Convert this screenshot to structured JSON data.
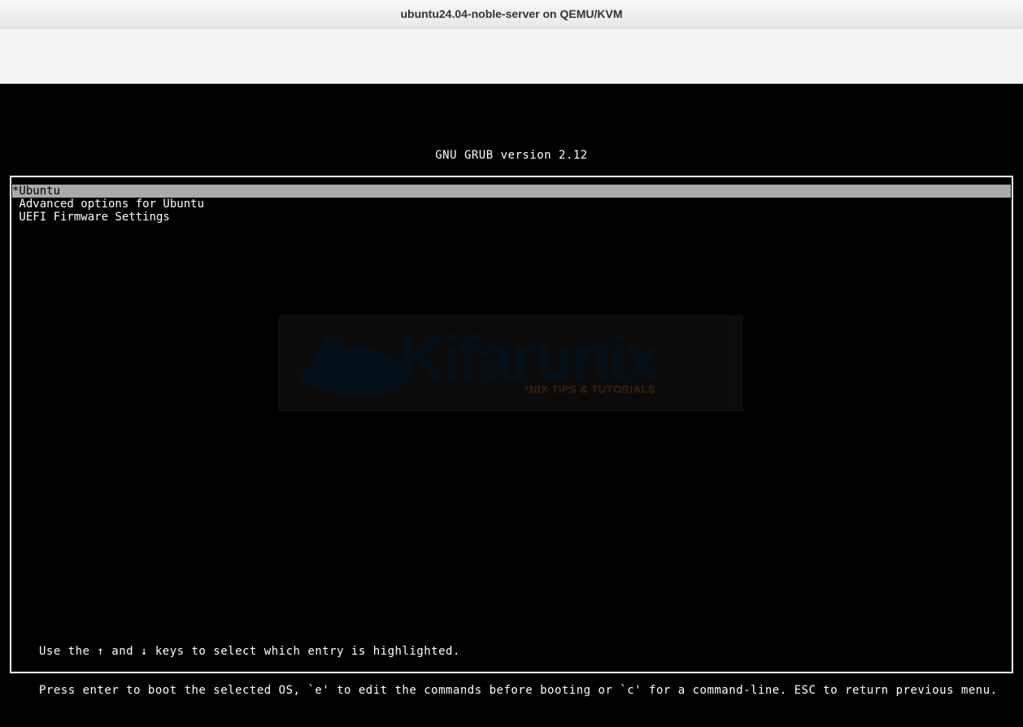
{
  "window": {
    "title": "ubuntu24.04-noble-server on QEMU/KVM"
  },
  "grub": {
    "header": "GNU GRUB  version 2.12",
    "menu": [
      {
        "label": "*Ubuntu",
        "selected": true
      },
      {
        "label": " Advanced options for Ubuntu",
        "selected": false
      },
      {
        "label": " UEFI Firmware Settings",
        "selected": false
      }
    ],
    "help_line1": "Use the ↑ and ↓ keys to select which entry is highlighted.",
    "help_line2": "Press enter to boot the selected OS, `e' to edit the commands before booting or `c' for a command-line. ESC to return previous menu."
  },
  "watermark": {
    "brand": "Kifarunix",
    "tagline": "*NIX TIPS & TUTORIALS"
  }
}
